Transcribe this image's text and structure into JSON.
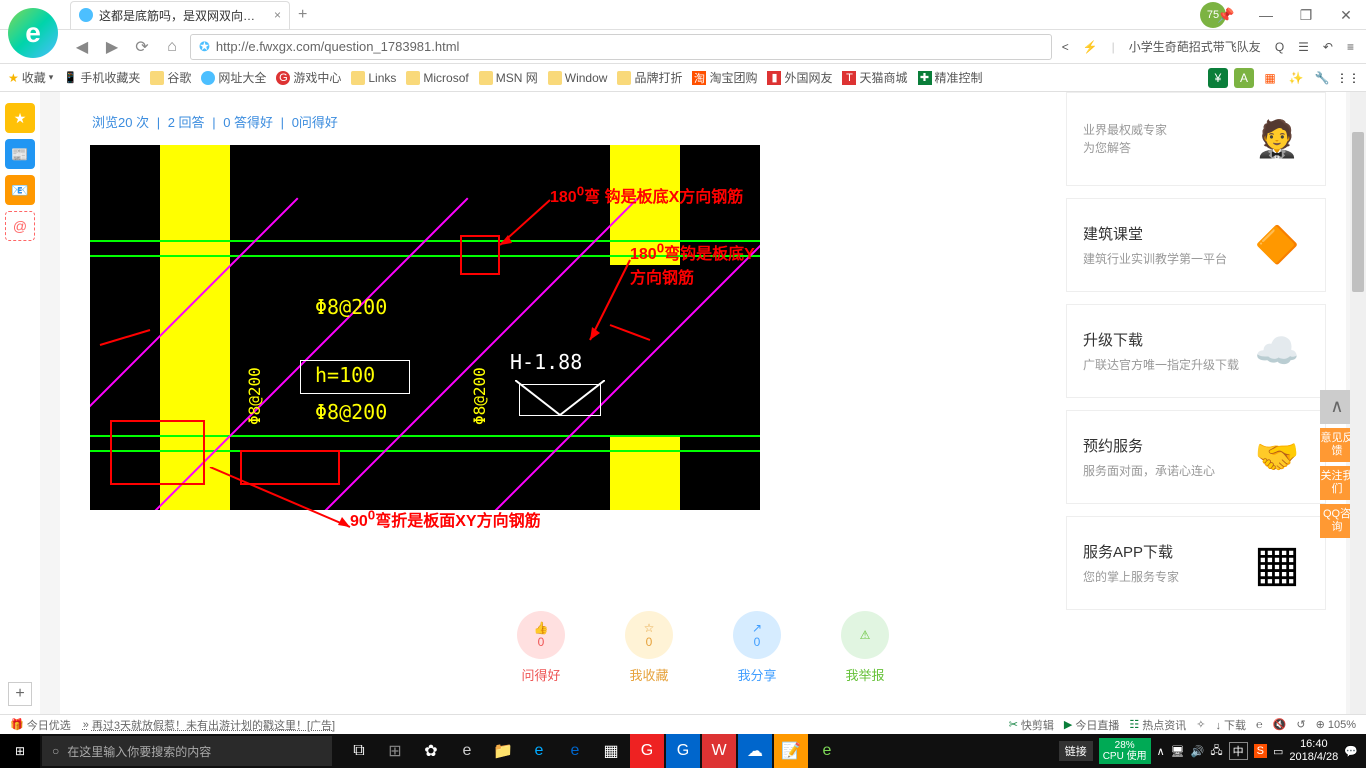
{
  "browser": {
    "tab_title": "这都是底筋吗，是双网双向布置",
    "tab_add": "+",
    "score": "75",
    "url_display": "http://e.fwxgx.com/question_1783981.html",
    "search_hint": "小学生奇葩招式带飞队友",
    "window": {
      "pin": "📌",
      "min": "—",
      "max": "❐",
      "close": "✕"
    },
    "nav": {
      "back": "◀",
      "forward": "▶",
      "refresh": "⟳",
      "home": "⌂"
    }
  },
  "bookmarks": {
    "fav": "收藏",
    "items": [
      "手机收藏夹",
      "谷歌",
      "网址大全",
      "游戏中心",
      "Links",
      "Microsof",
      "MSN 网",
      "Window",
      "品牌打折",
      "淘宝团购",
      "外国网友",
      "天猫商城",
      "精准控制"
    ]
  },
  "left_icons": [
    "★",
    "📰",
    "📧",
    "@"
  ],
  "page": {
    "meta": {
      "views": "浏览20 次",
      "answers": "2 回答",
      "good": "0 答得好",
      "ask": "0问得好",
      "sep": "|"
    },
    "annotations": {
      "a1_deg": "180",
      "a1_sup": "0",
      "a1_text": "弯  钩是板底X方向钢筋",
      "a2_deg": "180",
      "a2_sup": "0",
      "a2_text": "弯钩是板底Y方向钢筋",
      "a3_deg": "90",
      "a3_sup": "0",
      "a3_text": "弯折是板面XY方向钢筋"
    },
    "cad": {
      "t1": "Φ8@200",
      "t2": "h=100",
      "t3": "Φ8@200",
      "t4": "H-1.88",
      "t5": "Φ8@200",
      "t6": "Φ8@200"
    },
    "actions": [
      {
        "count": "0",
        "label": "问得好",
        "color": "red",
        "icon": "👍"
      },
      {
        "count": "0",
        "label": "我收藏",
        "color": "yellow",
        "icon": "☆"
      },
      {
        "count": "0",
        "label": "我分享",
        "color": "blue",
        "icon": "↗"
      },
      {
        "count": "",
        "label": "我举报",
        "color": "green",
        "icon": "⚠"
      }
    ]
  },
  "right_cards": [
    {
      "title": "",
      "desc": "业界最权威专家\n为您解答",
      "icon": "🤵"
    },
    {
      "title": "建筑课堂",
      "desc": "建筑行业实训教学第一平台",
      "icon": "🔶"
    },
    {
      "title": "升级下载",
      "desc": "广联达官方唯一指定升级下载",
      "icon": "☁️"
    },
    {
      "title": "预约服务",
      "desc": "服务面对面，承诺心连心",
      "icon": "🤝"
    },
    {
      "title": "服务APP下载",
      "desc": "您的掌上服务专家",
      "icon": "▦"
    }
  ],
  "float_buttons": [
    "意见反馈",
    "关注我们",
    "QQ咨询"
  ],
  "float_top": "∧",
  "bottombar": {
    "today": "今日优选",
    "ad": "再过3天就放假惹！未有出游计划的戳这里！[广告]",
    "right": [
      "快剪辑",
      "今日直播",
      "热点资讯",
      "✧",
      "↓ 下载",
      "℮",
      "⊕ 105%"
    ]
  },
  "taskbar": {
    "search_placeholder": "在这里输入你要搜索的内容",
    "link": "链接",
    "cpu": "28%\nCPU 使用",
    "time": "16:40",
    "date": "2018/4/28",
    "ime": "中"
  }
}
